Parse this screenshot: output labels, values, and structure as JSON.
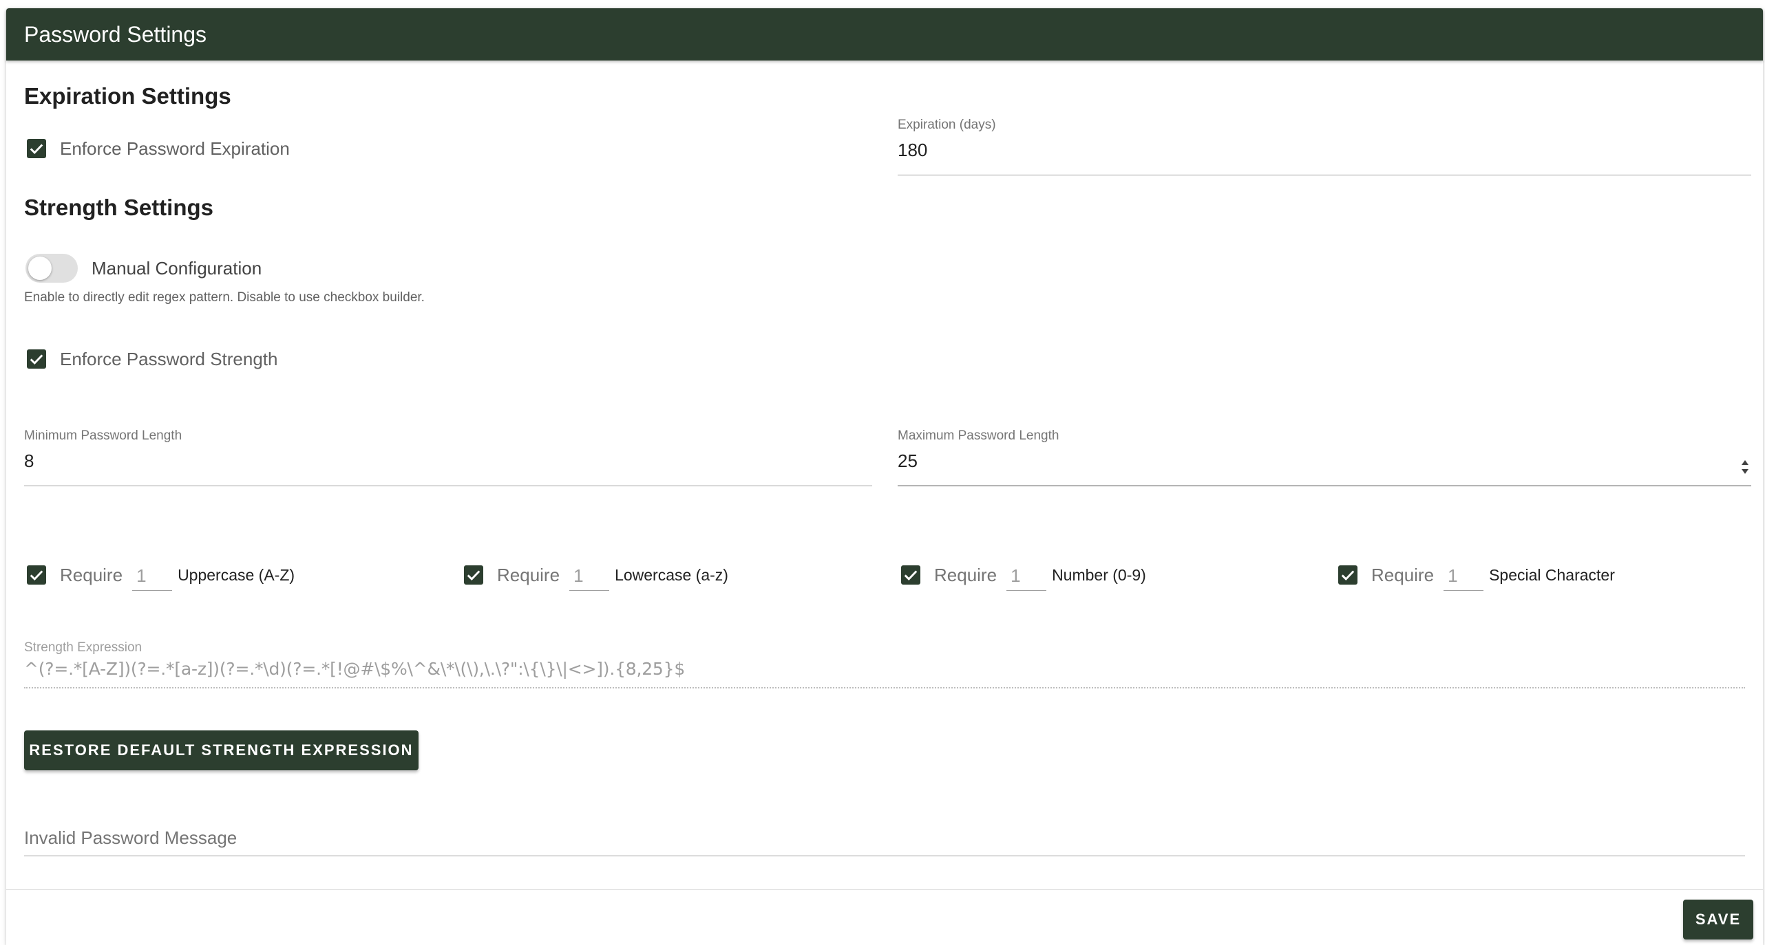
{
  "header": {
    "title": "Password Settings"
  },
  "colors": {
    "primary": "#2c3e2f",
    "text": "#212121",
    "muted": "#757575",
    "divider": "#9e9e9e"
  },
  "expiration": {
    "section_title": "Expiration Settings",
    "enforce_label": "Enforce Password Expiration",
    "enforce_checked": true,
    "days_label": "Expiration (days)",
    "days_value": "180"
  },
  "strength": {
    "section_title": "Strength Settings",
    "manual_toggle_label": "Manual Configuration",
    "manual_toggle_on": false,
    "manual_hint": "Enable to directly edit regex pattern. Disable to use checkbox builder.",
    "enforce_label": "Enforce Password Strength",
    "enforce_checked": true,
    "min_length_label": "Minimum Password Length",
    "min_length_value": "8",
    "max_length_label": "Maximum Password Length",
    "max_length_value": "25",
    "requirements": [
      {
        "require_label": "Require",
        "count": "1",
        "type": "Uppercase (A-Z)",
        "checked": true
      },
      {
        "require_label": "Require",
        "count": "1",
        "type": "Lowercase (a-z)",
        "checked": true
      },
      {
        "require_label": "Require",
        "count": "1",
        "type": "Number (0-9)",
        "checked": true
      },
      {
        "require_label": "Require",
        "count": "1",
        "type": "Special Character",
        "checked": true
      }
    ],
    "expression_label": "Strength Expression",
    "expression_value": "^(?=.*[A-Z])(?=.*[a-z])(?=.*\\d)(?=.*[!@#\\$%\\^&\\*\\(\\),\\.\\?\":\\{\\}\\|<>]).{8,25}$",
    "restore_button": "RESTORE DEFAULT STRENGTH EXPRESSION",
    "invalid_message_placeholder": "Invalid Password Message"
  },
  "footer": {
    "save_button": "SAVE"
  },
  "icons": {
    "checkbox": "check-icon",
    "spinner": "spin-arrows-icon"
  }
}
